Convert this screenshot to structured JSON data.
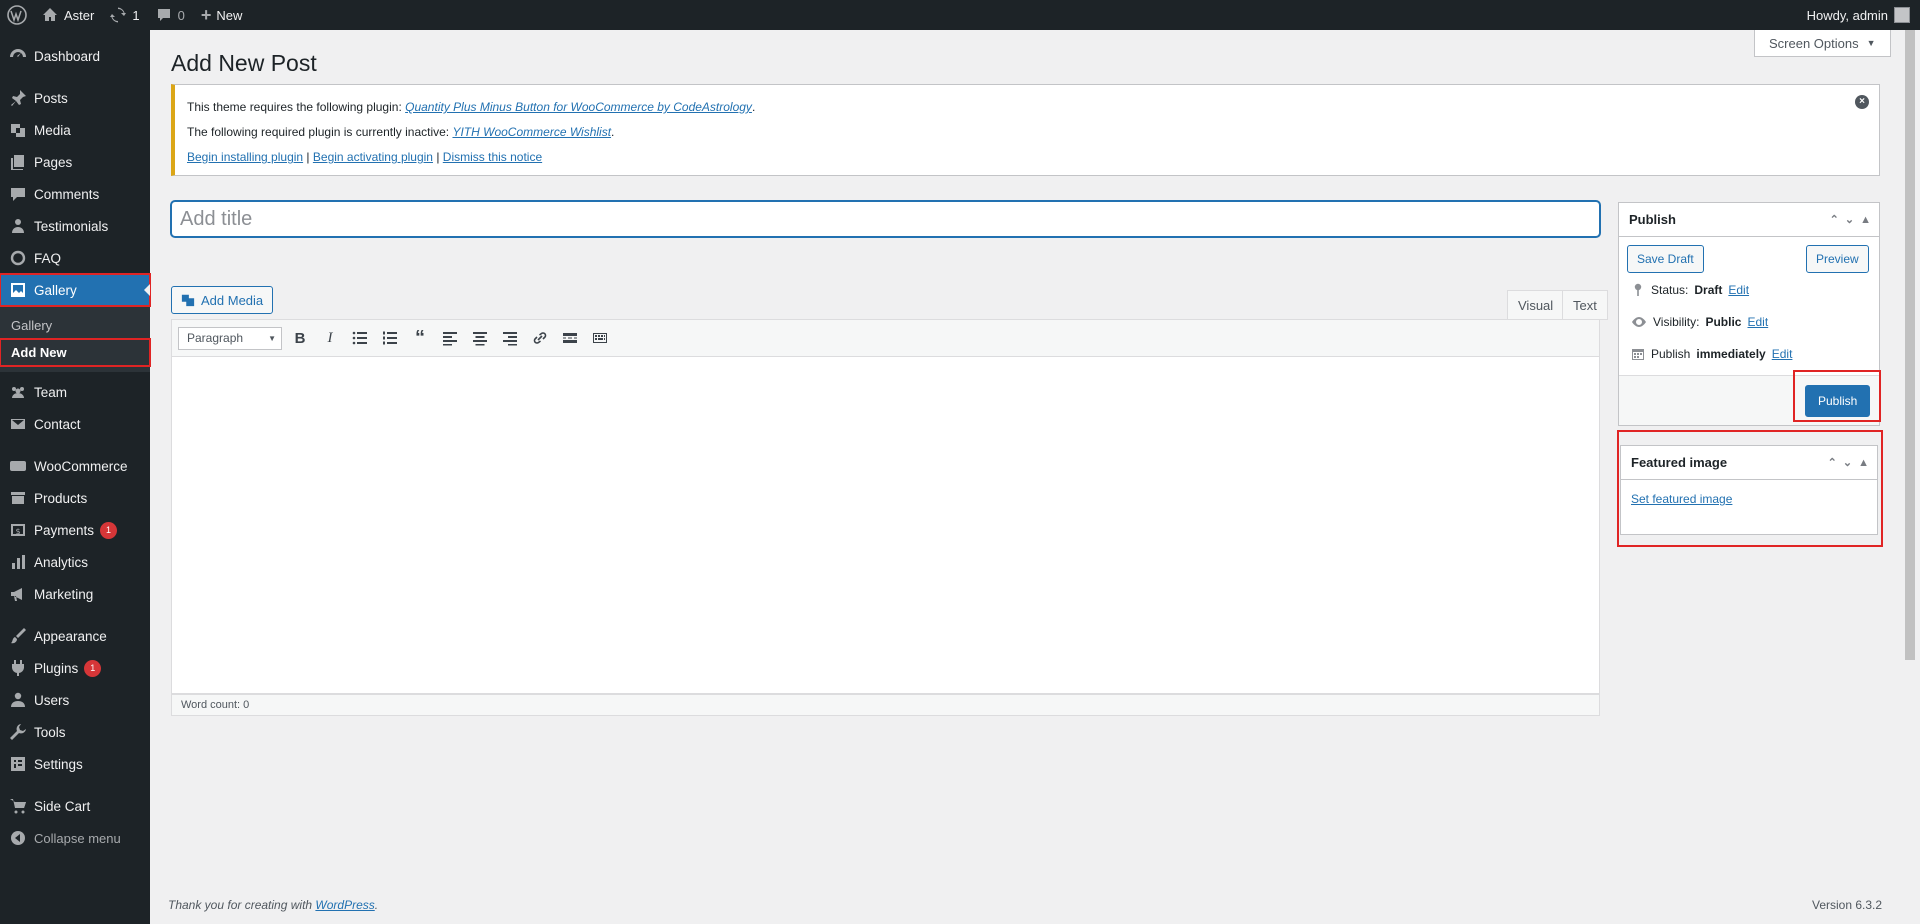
{
  "adminbar": {
    "site_name": "Aster",
    "updates_count": "1",
    "comments_count": "0",
    "new_label": "New",
    "howdy": "Howdy, admin"
  },
  "sidebar": {
    "items": [
      {
        "label": "Dashboard",
        "icon": "dashboard-icon"
      },
      {
        "label": "Posts",
        "icon": "pin-icon"
      },
      {
        "label": "Media",
        "icon": "media-icon"
      },
      {
        "label": "Pages",
        "icon": "pages-icon"
      },
      {
        "label": "Comments",
        "icon": "comments-icon"
      },
      {
        "label": "Testimonials",
        "icon": "users-icon"
      },
      {
        "label": "FAQ",
        "icon": "circle-icon"
      },
      {
        "label": "Gallery",
        "icon": "gallery-icon"
      },
      {
        "label": "Team",
        "icon": "team-icon"
      },
      {
        "label": "Contact",
        "icon": "mail-icon"
      },
      {
        "label": "WooCommerce",
        "icon": "woo-icon"
      },
      {
        "label": "Products",
        "icon": "archive-icon"
      },
      {
        "label": "Payments",
        "icon": "dollar-icon",
        "badge": "1"
      },
      {
        "label": "Analytics",
        "icon": "chart-icon"
      },
      {
        "label": "Marketing",
        "icon": "megaphone-icon"
      },
      {
        "label": "Appearance",
        "icon": "brush-icon"
      },
      {
        "label": "Plugins",
        "icon": "plugin-icon",
        "badge": "1"
      },
      {
        "label": "Users",
        "icon": "user-icon"
      },
      {
        "label": "Tools",
        "icon": "wrench-icon"
      },
      {
        "label": "Settings",
        "icon": "settings-icon"
      },
      {
        "label": "Side Cart",
        "icon": "cart-icon"
      }
    ],
    "submenu": [
      "Gallery",
      "Add New"
    ],
    "collapse": "Collapse menu"
  },
  "page": {
    "title": "Add New Post",
    "screen_options": "Screen Options"
  },
  "notice": {
    "line1_text": "This theme requires the following plugin: ",
    "line1_link": "Quantity Plus Minus Button for WooCommerce by CodeAstrology",
    "line2_text": "The following required plugin is currently inactive: ",
    "line2_link": "YITH WooCommerce Wishlist",
    "link_install": "Begin installing plugin",
    "link_activate": "Begin activating plugin",
    "link_dismiss": "Dismiss this notice",
    "sep": " | "
  },
  "editor": {
    "title_placeholder": "Add title",
    "add_media": "Add Media",
    "tab_visual": "Visual",
    "tab_text": "Text",
    "format": "Paragraph",
    "word_count": "Word count: 0"
  },
  "publish": {
    "heading": "Publish",
    "save_draft": "Save Draft",
    "preview": "Preview",
    "status_label": "Status: ",
    "status_value": "Draft",
    "visibility_label": "Visibility: ",
    "visibility_value": "Public",
    "publish_label": "Publish ",
    "publish_value": "immediately",
    "edit": "Edit",
    "publish_button": "Publish"
  },
  "featured": {
    "heading": "Featured image",
    "link": "Set featured image"
  },
  "footer": {
    "thanks": "Thank you for creating with ",
    "wp_link": "WordPress",
    "period": ".",
    "version": "Version 6.3.2"
  }
}
